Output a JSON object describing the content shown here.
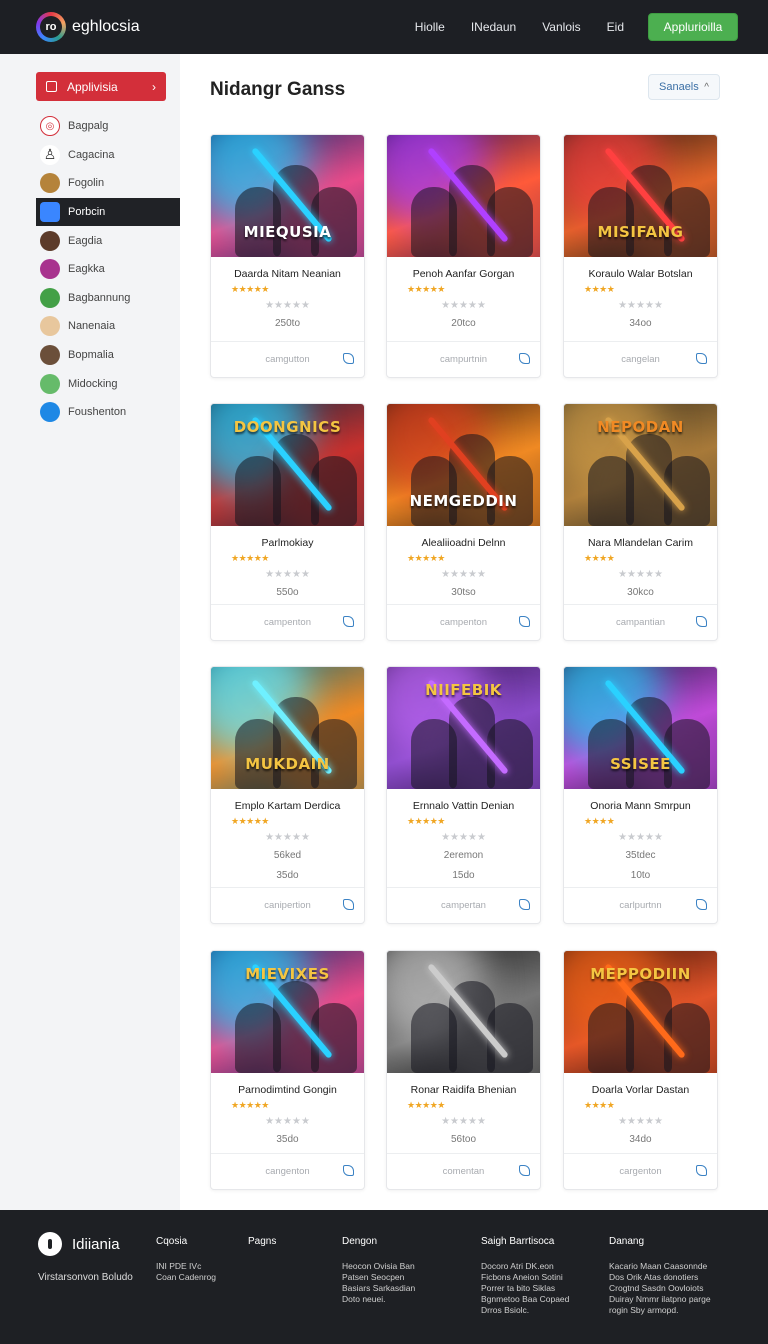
{
  "app": {
    "brand": "eghlocsia",
    "logo_text": "ro"
  },
  "topnav": {
    "links": [
      "Hiolle",
      "INedaun",
      "Vanlois",
      "Eid"
    ],
    "cta": "Applurioilla"
  },
  "sidebar": {
    "top_button": "Applivisia",
    "items": [
      {
        "label": "Bagpalg",
        "color": "#ffffff",
        "icon": "shield-icon"
      },
      {
        "label": "Cagacina",
        "color": "#ffffff",
        "icon": "user-icon"
      },
      {
        "label": "Fogolin",
        "color": "#b5833a",
        "icon": "avatar-icon"
      },
      {
        "label": "Porbcin",
        "color": "#3a86ff",
        "icon": "app-icon",
        "active": true
      },
      {
        "label": "Eagdia",
        "color": "#5c3b2a",
        "icon": "avatar-icon"
      },
      {
        "label": "Eagkka",
        "color": "#a8338e",
        "icon": "avatar-icon"
      },
      {
        "label": "Bagbannung",
        "color": "#43a047",
        "icon": "avatar-icon"
      },
      {
        "label": "Nanenaia",
        "color": "#e8c79d",
        "icon": "avatar-icon"
      },
      {
        "label": "Bopmalia",
        "color": "#6b4f3a",
        "icon": "avatar-icon"
      },
      {
        "label": "Midocking",
        "color": "#66bb6a",
        "icon": "avatar-icon"
      },
      {
        "label": "Foushenton",
        "color": "#1e88e5",
        "icon": "avatar-icon"
      }
    ]
  },
  "main": {
    "heading": "Nidangr Ganss",
    "sort_label": "Sanaels"
  },
  "cards": [
    {
      "name": "Daarda Nitam Neanian",
      "stars": "★★★★★",
      "meta": "250to",
      "meta2": "",
      "footer": "camgutton",
      "thumb_title": "MIEQUSIA",
      "c1": "#1d2b6b",
      "c2": "#e94b8a",
      "c3": "#2ad1ff",
      "tcolor": "#ffffff"
    },
    {
      "name": "Penoh Aanfar Gorgan",
      "stars": "★★★★★",
      "meta": "20tco",
      "meta2": "",
      "footer": "campurtnin",
      "thumb_title": "",
      "c1": "#3b1450",
      "c2": "#ff5b3a",
      "c3": "#b040ff",
      "tcolor": "#ffffff"
    },
    {
      "name": "Koraulo Walar Botslan",
      "stars": "★★★★",
      "meta": "34oo",
      "meta2": "",
      "footer": "cangelan",
      "thumb_title": "MISIFANG",
      "c1": "#2a1c14",
      "c2": "#e0642a",
      "c3": "#ff4040",
      "tcolor": "#f4c542"
    },
    {
      "name": "Parlmokiay",
      "stars": "★★★★★",
      "meta": "550o",
      "meta2": "",
      "footer": "campenton",
      "thumb_title": "DOONGNICS",
      "c1": "#1b2a3f",
      "c2": "#c8312e",
      "c3": "#2ad1ff",
      "tcolor": "#f4c542"
    },
    {
      "name": "Alealiioadni Delnn",
      "stars": "★★★★★",
      "meta": "30tso",
      "meta2": "",
      "footer": "campenton",
      "thumb_title": "NEMGEDDIN",
      "c1": "#3d1e0f",
      "c2": "#f08a24",
      "c3": "#e04020",
      "tcolor": "#ffffff"
    },
    {
      "name": "Nara Mlandelan Carim",
      "stars": "★★★★",
      "meta": "30kco",
      "meta2": "",
      "footer": "campantian",
      "thumb_title": "NEPODAN",
      "c1": "#3a3220",
      "c2": "#a87a3a",
      "c3": "#d8a24a",
      "tcolor": "#f08a24"
    },
    {
      "name": "Emplo Kartam Derdica",
      "stars": "★★★★★",
      "meta": "56ked",
      "meta2": "35do",
      "footer": "canipertion",
      "thumb_title": "MUKDAIN",
      "c1": "#1e6b7a",
      "c2": "#f08a24",
      "c3": "#6ff0ff",
      "tcolor": "#f4c542"
    },
    {
      "name": "Ernnalo Vattin Denian",
      "stars": "★★★★★",
      "meta": "2eremon",
      "meta2": "15do",
      "footer": "campertan",
      "thumb_title": "NIIFEBIK",
      "c1": "#3b1a5a",
      "c2": "#8a4bc8",
      "c3": "#c46bff",
      "tcolor": "#f4c542"
    },
    {
      "name": "Onoria Mann Smrpun",
      "stars": "★★★★",
      "meta": "35tdec",
      "meta2": "10to",
      "footer": "carlpurtnn",
      "thumb_title": "SSISEE",
      "c1": "#2a1a4a",
      "c2": "#c04bd8",
      "c3": "#2ad1ff",
      "tcolor": "#f4c542"
    },
    {
      "name": "Parnodimtind Gongin",
      "stars": "★★★★★",
      "meta": "35do",
      "meta2": "",
      "footer": "cangenton",
      "thumb_title": "MIEVIXES",
      "c1": "#1d2b6b",
      "c2": "#e94b8a",
      "c3": "#2ad1ff",
      "tcolor": "#f4c542"
    },
    {
      "name": "Ronar Raidifa Bhenian",
      "stars": "★★★★★",
      "meta": "56too",
      "meta2": "",
      "footer": "comentan",
      "thumb_title": "",
      "c1": "#1a1a1a",
      "c2": "#777777",
      "c3": "#cccccc",
      "tcolor": "#ffffff"
    },
    {
      "name": "Doarla Vorlar Dastan",
      "stars": "★★★★",
      "meta": "34do",
      "meta2": "",
      "footer": "cargenton",
      "thumb_title": "MEPPODIIN",
      "c1": "#3d140a",
      "c2": "#e0542a",
      "c3": "#ff6a1a",
      "tcolor": "#f4c542"
    }
  ],
  "footer": {
    "brand": "Idiiania",
    "tagline": "Virstarsonvon Boludo",
    "cols": [
      {
        "h": "Cqosia",
        "t": "INI PDE IVc\nCoan Cadenrog"
      },
      {
        "h": "Pagns",
        "t": ""
      },
      {
        "h": "Dengon",
        "t": "Heocon Ovisia Ban\nPatsen Seocpen\nBasiars Sarkasdian\nDoto neuei."
      },
      {
        "h": "Saigh Barrtisoca",
        "t": "Docoro Atri DK.eon\nFicbons Aneion Sotini\nPorrer ta bito Siklas\nBgnmetoo Baa Copaed\nDrros Bsiolc."
      },
      {
        "h": "Danang",
        "t": "Kacario Maan Caasonnde\nDos Orik Atas donotiers\nCrogtnd Sasdn Oovloiots\nDuiray Nmmr ilatpno parge\nrogin Sby armopd."
      }
    ]
  }
}
